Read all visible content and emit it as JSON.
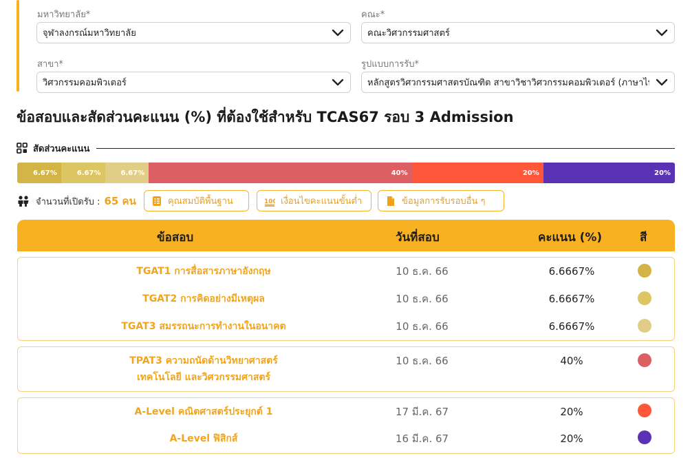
{
  "filters": {
    "university": {
      "label": "มหาวิทยาลัย*",
      "value": "จุฬาลงกรณ์มหาวิทยาลัย"
    },
    "faculty": {
      "label": "คณะ*",
      "value": "คณะวิศวกรรมศาสตร์"
    },
    "major": {
      "label": "สาขา*",
      "value": "วิศวกรรมคอมพิวเตอร์"
    },
    "program": {
      "label": "รูปแบบการรับ*",
      "value": "หลักสูตรวิศวกรรมศาสตรบัณฑิต สาขาวิชาวิศวกรรมคอมพิวเตอร์ (ภาษาไทย)"
    }
  },
  "heading": "ข้อสอบและสัดส่วนคะแนน (%) ที่ต้องใช้สำหรับ TCAS67 รอบ 3 Admission",
  "ratio_section": {
    "label": "สัดส่วนคะแนน",
    "icon": "grid-icon",
    "segments": [
      {
        "label": "6.67%",
        "percent": 6.67,
        "color": "#d3b547"
      },
      {
        "label": "6.67%",
        "percent": 6.67,
        "color": "#dcc563"
      },
      {
        "label": "6.67%",
        "percent": 6.67,
        "color": "#e0ce86"
      },
      {
        "label": "40%",
        "percent": 40,
        "color": "#dc5f63"
      },
      {
        "label": "20%",
        "percent": 20,
        "color": "#ff573a"
      },
      {
        "label": "20%",
        "percent": 20,
        "color": "#5a33b4"
      }
    ]
  },
  "seats": {
    "label": "จำนวนที่เปิดรับ :",
    "count": "65 คน",
    "icon": "people-icon"
  },
  "buttons": {
    "qualifications": {
      "label": "คุณสมบัติพื้นฐาน",
      "icon": "list-icon"
    },
    "min_scores": {
      "label": "เงื่อนไขคะแนนขั้นต่ำ",
      "icon": "hundred-icon"
    },
    "other_rounds": {
      "label": "ข้อมูลการรับรอบอื่น ๆ",
      "icon": "document-icon"
    }
  },
  "table": {
    "headers": {
      "subject": "ข้อสอบ",
      "date": "วันที่สอบ",
      "score": "คะแนน (%)",
      "color": "สี"
    },
    "groups": [
      {
        "rows": [
          {
            "subject": "TGAT1 การสื่อสารภาษาอังกฤษ",
            "date": "10 ธ.ค. 66",
            "score": "6.6667%",
            "color": "#d3b547"
          },
          {
            "subject": "TGAT2 การคิดอย่างมีเหตุผล",
            "date": "10 ธ.ค. 66",
            "score": "6.6667%",
            "color": "#dcc563"
          },
          {
            "subject": "TGAT3 สมรรถนะการทำงานในอนาคต",
            "date": "10 ธ.ค. 66",
            "score": "6.6667%",
            "color": "#e0ce86"
          }
        ]
      },
      {
        "rows": [
          {
            "subject": "TPAT3 ความถนัดด้านวิทยาศาสตร์ เทคโนโลยี และวิศวกรรมศาสตร์",
            "date": "10 ธ.ค. 66",
            "score": "40%",
            "color": "#dc5f63"
          }
        ]
      },
      {
        "rows": [
          {
            "subject": "A-Level คณิตศาสตร์ประยุกต์ 1",
            "date": "17 มี.ค. 67",
            "score": "20%",
            "color": "#ff573a"
          },
          {
            "subject": "A-Level ฟิสิกส์",
            "date": "16 มี.ค. 67",
            "score": "20%",
            "color": "#5a33b4"
          }
        ]
      }
    ]
  }
}
